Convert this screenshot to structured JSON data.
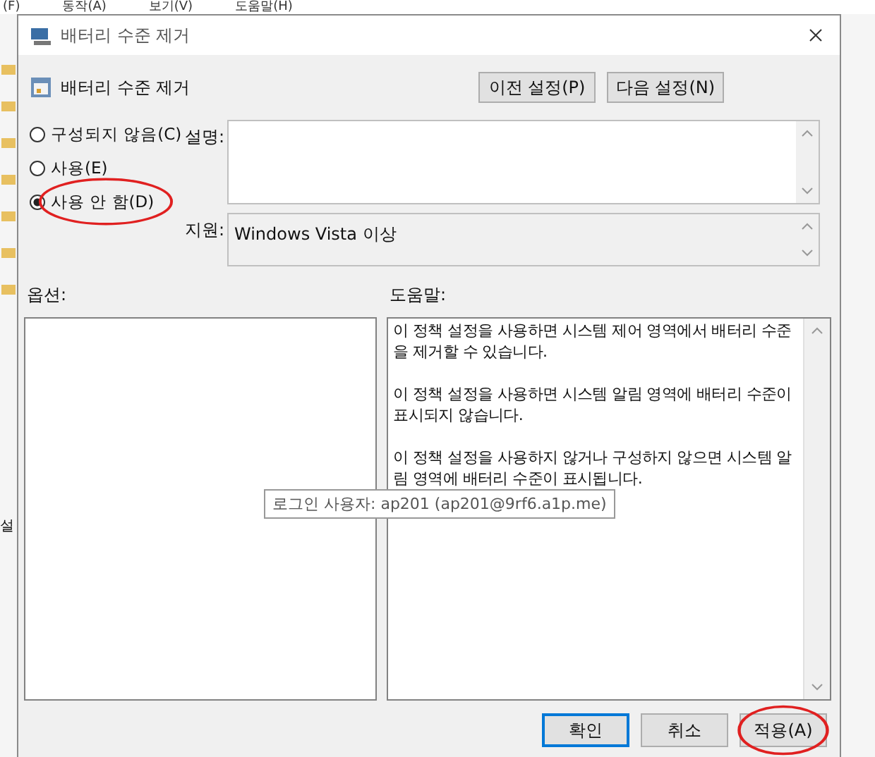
{
  "background_window": {
    "menu": [
      "(F)",
      "동작(A)",
      "보기(V)",
      "도움말(H)"
    ],
    "side_label": "설"
  },
  "window": {
    "title": "배터리 수준 제거"
  },
  "header": {
    "title": "배터리 수준 제거",
    "buttons": [
      "이전 설정(P)",
      "다음 설정(N)"
    ]
  },
  "states": [
    {
      "label": "구성되지 않음(C)",
      "selected": false,
      "circled": false
    },
    {
      "label": "사용(E)",
      "selected": false,
      "circled": false
    },
    {
      "label": "사용 안 함(D)",
      "selected": true,
      "circled": true
    }
  ],
  "comment": {
    "label": "설명:"
  },
  "supported": {
    "label": "지원:",
    "value": "Windows Vista 이상"
  },
  "options_panel": {
    "label": "옵션:"
  },
  "help_panel": {
    "label": "도움말:",
    "paragraphs": [
      "이 정책 설정을 사용하면 시스템 제어 영역에서 배터리 수준을 제거할 수 있습니다.",
      "이 정책 설정을 사용하면 시스템 알림 영역에 배터리 수준이 표시되지 않습니다.",
      "이 정책 설정을 사용하지 않거나 구성하지 않으면 시스템 알림 영역에 배터리 수준이 표시됩니다."
    ]
  },
  "tooltip": "로그인 사용자: ap201 (ap201@9rf6.a1p.me)",
  "buttons": [
    {
      "label": "확인",
      "default": true,
      "circled": false
    },
    {
      "label": "취소",
      "default": false,
      "circled": false
    },
    {
      "label": "적용(A)",
      "default": false,
      "circled": true
    }
  ]
}
